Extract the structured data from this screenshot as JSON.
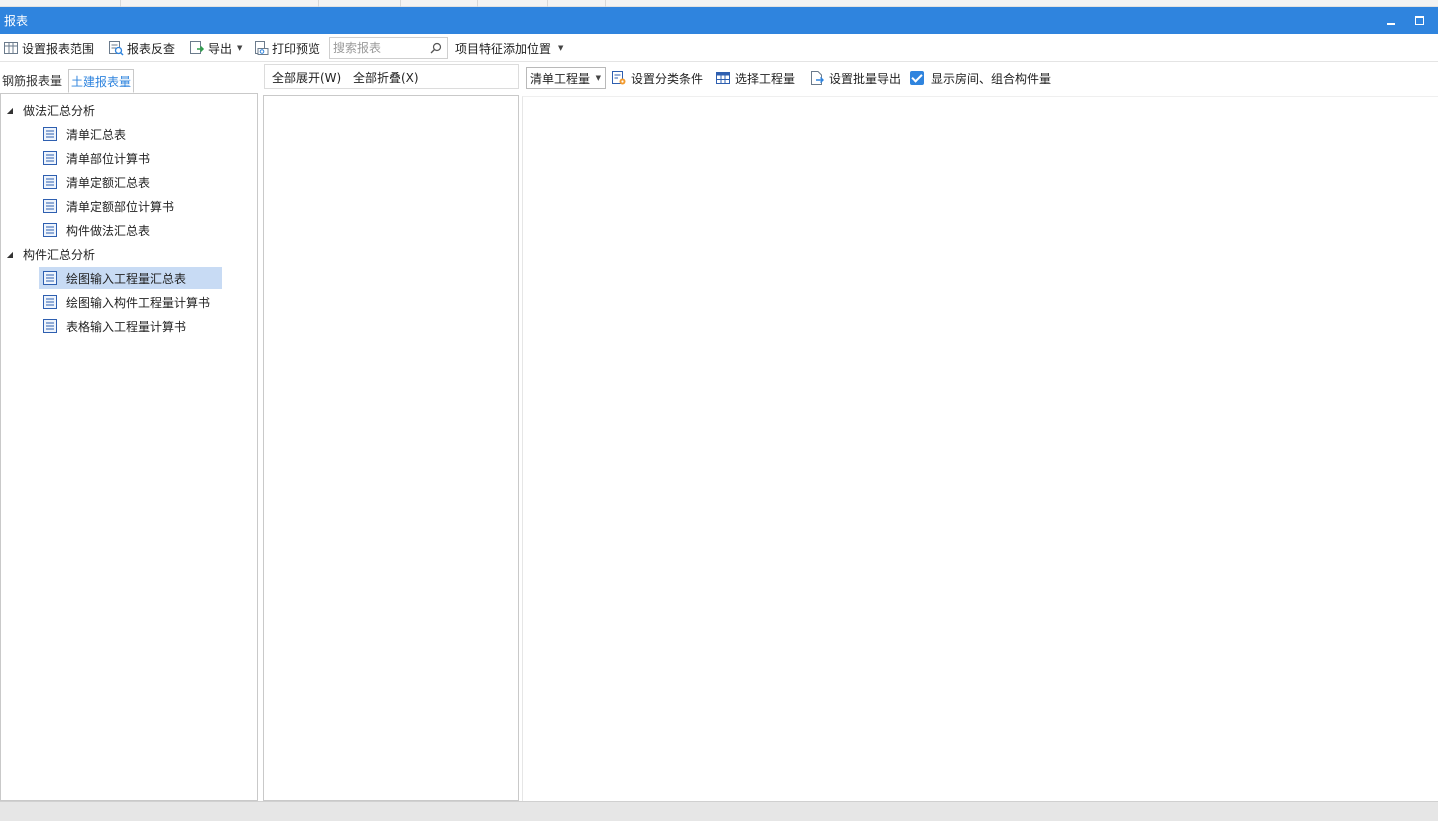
{
  "window": {
    "title": "报表"
  },
  "toolbar": {
    "set_range": "设置报表范围",
    "report_check": "报表反查",
    "export": "导出",
    "print_preview": "打印预览",
    "search_placeholder": "搜索报表",
    "feature_position": "项目特征添加位置"
  },
  "left_tabs": {
    "steel": "钢筋报表量",
    "civil": "土建报表量"
  },
  "tree": {
    "groups": [
      {
        "label": "做法汇总分析",
        "items": [
          {
            "label": "清单汇总表"
          },
          {
            "label": "清单部位计算书"
          },
          {
            "label": "清单定额汇总表"
          },
          {
            "label": "清单定额部位计算书"
          },
          {
            "label": "构件做法汇总表"
          }
        ]
      },
      {
        "label": "构件汇总分析",
        "items": [
          {
            "label": "绘图输入工程量汇总表",
            "selected": true
          },
          {
            "label": "绘图输入构件工程量计算书"
          },
          {
            "label": "表格输入工程量计算书"
          }
        ]
      }
    ]
  },
  "middle": {
    "expand_all": "全部展开(W)",
    "collapse_all": "全部折叠(X)"
  },
  "right_toolbar": {
    "quantity_type": "清单工程量",
    "set_category": "设置分类条件",
    "select_quantity": "选择工程量",
    "batch_export": "设置批量导出",
    "show_rooms": "显示房间、组合构件量",
    "show_rooms_checked": true
  },
  "colors": {
    "accent": "#2f84de",
    "selected_row": "#c8dbf4",
    "checkbox": "#2f84de"
  }
}
